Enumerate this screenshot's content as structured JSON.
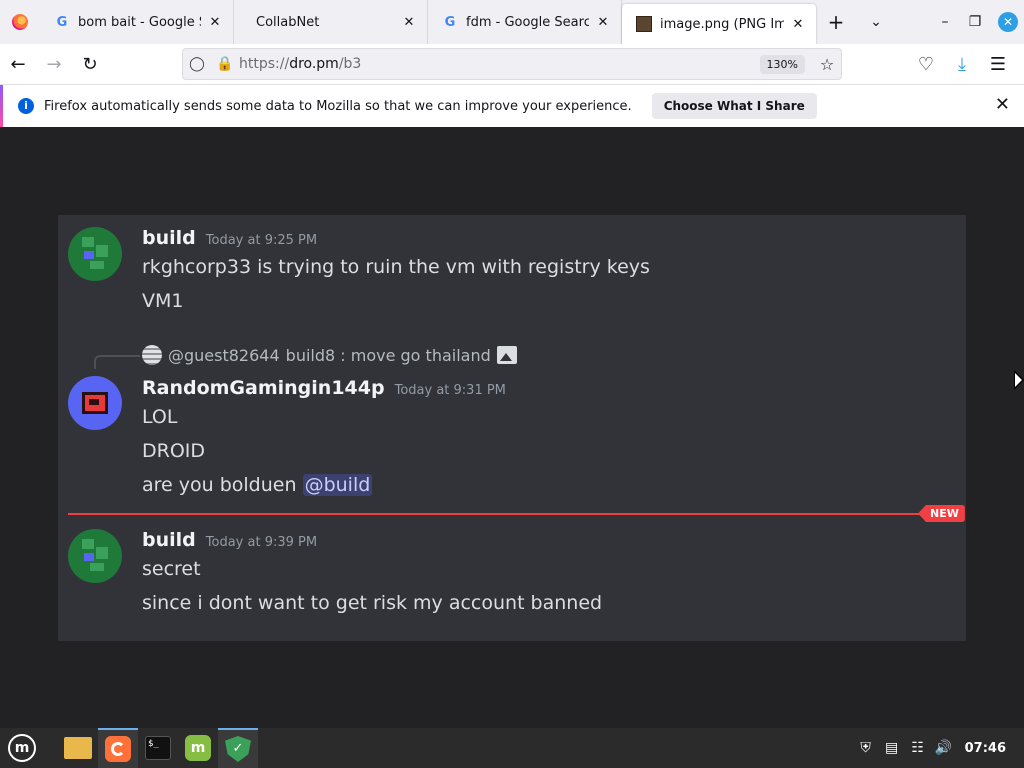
{
  "browser": {
    "tabs": [
      {
        "title": "bom bait - Google Sear",
        "icon": "google-icon",
        "active": false
      },
      {
        "title": "CollabNet",
        "icon": "none",
        "active": false
      },
      {
        "title": "fdm - Google Search",
        "icon": "google-icon",
        "active": false
      },
      {
        "title": "image.png (PNG Image",
        "icon": "image-icon",
        "active": true
      }
    ],
    "tab_close_glyph": "✕",
    "new_tab_glyph": "+",
    "url_scheme": "https://",
    "url_host": "dro.pm",
    "url_path": "/b3",
    "zoom": "130%"
  },
  "notification": {
    "text": "Firefox automatically sends some data to Mozilla so that we can improve your experience.",
    "button": "Choose What I Share"
  },
  "chat": {
    "messages": [
      {
        "username": "build",
        "timestamp": "Today at 9:25 PM",
        "lines": [
          "rkghcorp33 is trying to ruin the vm with registry keys",
          "VM1"
        ]
      },
      {
        "reply": {
          "user": "@guest82644",
          "text": "build8 : move go thailand"
        },
        "username": "RandomGamingin144p",
        "timestamp": "Today at 9:31 PM",
        "lines": [
          "LOL",
          "DROID",
          "are you bolduen"
        ],
        "mention": "@build"
      },
      {
        "username": "build",
        "timestamp": "Today at 9:39 PM",
        "lines": [
          "secret",
          "since i dont want to get risk my account banned"
        ]
      }
    ],
    "new_badge": "NEW",
    "colors": {
      "background": "#313338",
      "username": "#f2f3f5",
      "text": "#dbdee1",
      "new_divider": "#f23f42",
      "mention_bg": "#5865f2"
    }
  },
  "taskbar": {
    "clock": "07:46",
    "apps": [
      "files-icon",
      "firefox-icon",
      "terminal-icon",
      "mint-update-icon",
      "shield-icon"
    ]
  }
}
